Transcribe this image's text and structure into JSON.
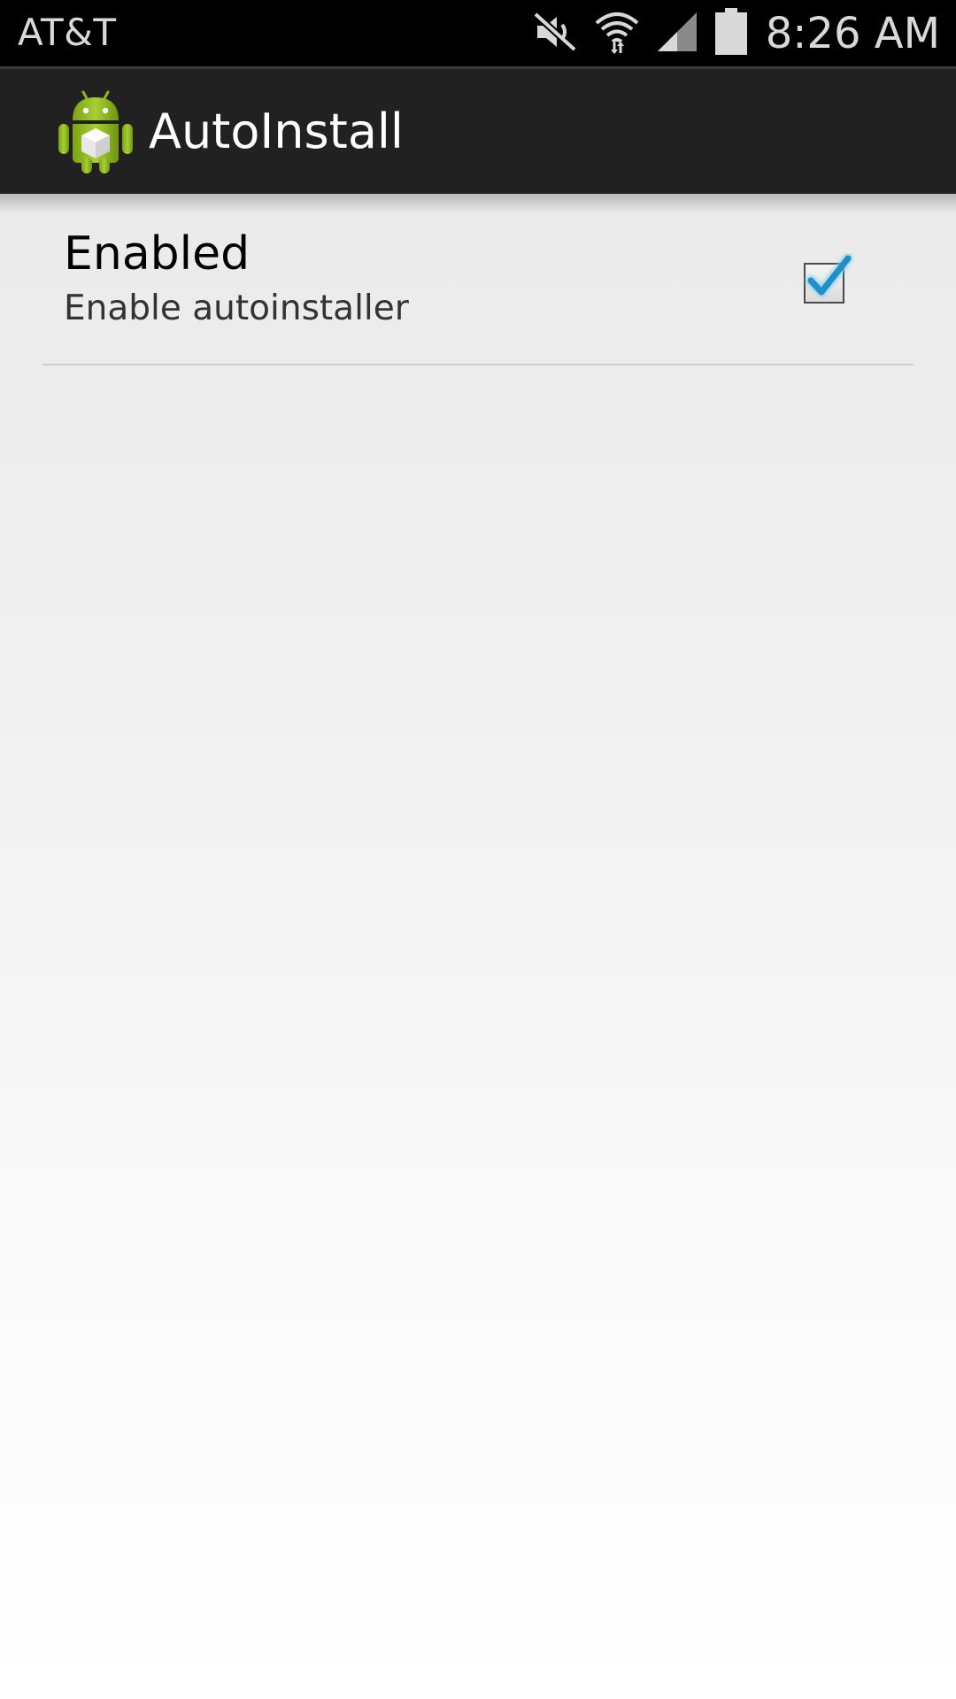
{
  "status_bar": {
    "carrier": "AT&T",
    "time": "8:26 AM",
    "icons": [
      "mute-icon",
      "wifi-icon",
      "signal-icon",
      "battery-icon"
    ]
  },
  "action_bar": {
    "icon": "android-app-icon",
    "title": "AutoInstall"
  },
  "preference": {
    "title": "Enabled",
    "summary": "Enable autoinstaller",
    "checked": true
  },
  "colors": {
    "status_bar_bg": "#000000",
    "action_bar_bg": "#212121",
    "check_accent": "#1e9ad6",
    "android_green": "#97c024"
  }
}
